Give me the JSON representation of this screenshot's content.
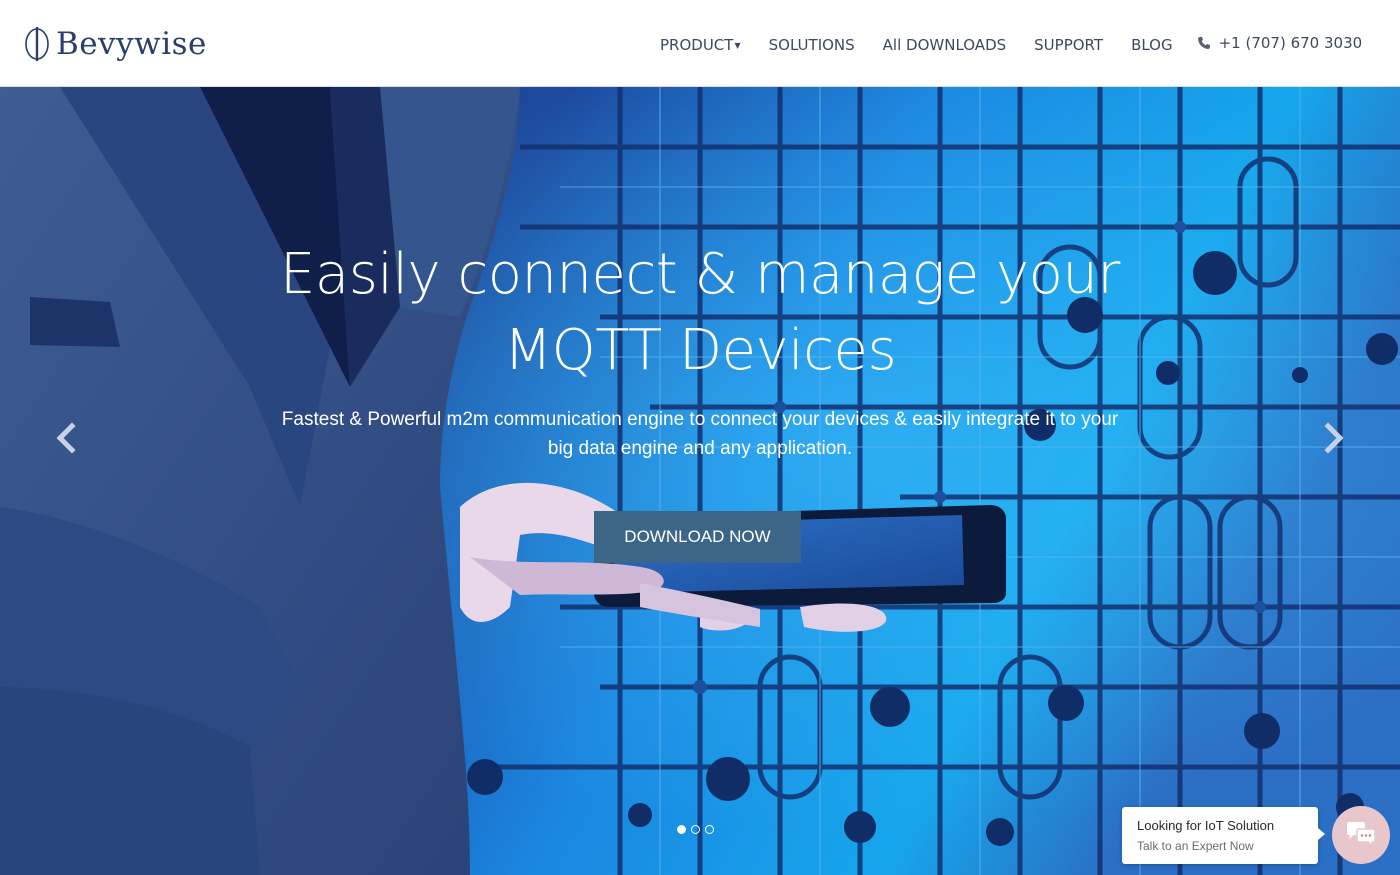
{
  "brand": {
    "logo_text": "Bevywise",
    "color": "#2a3e6e"
  },
  "nav": {
    "items": [
      {
        "label": "PRODUCT",
        "has_dropdown": true
      },
      {
        "label": "SOLUTIONS"
      },
      {
        "label": "All DOWNLOADS"
      },
      {
        "label": "SUPPORT"
      },
      {
        "label": "BLOG"
      }
    ],
    "phone": "+1 (707) 670 3030",
    "phone_icon": "phone-icon",
    "text_color": "#3c4a5e"
  },
  "hero": {
    "headline_line1": "Easily connect & manage your",
    "headline_line2": "MQTT Devices",
    "subline_line1": "Fastest & Powerful m2m communication engine to connect your devices & easily integrate it to your",
    "subline_line2": "big data engine and any application.",
    "cta_label": "DOWNLOAD NOW",
    "cta_color": "#3d6588",
    "prev_icon": "chevron-left-icon",
    "next_icon": "chevron-right-icon",
    "slides_total": 3,
    "slide_active": 1,
    "background_colors": [
      "#1a2f6e",
      "#1b7ad8",
      "#18a4ea"
    ]
  },
  "chat": {
    "title": "Looking for IoT Solution",
    "subtitle": "Talk to an Expert Now",
    "icon": "chat-bubbles-icon",
    "bubble_color": "#e7c6cc"
  }
}
